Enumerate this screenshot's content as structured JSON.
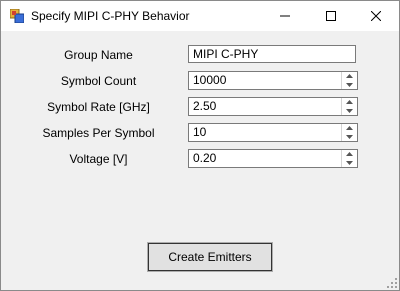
{
  "window": {
    "title": "Specify MIPI C-PHY Behavior",
    "controls": {
      "minimize": "–",
      "maximize": "☐",
      "close": "✕"
    },
    "icon": "app-icon"
  },
  "form": {
    "group_name": {
      "label": "Group Name",
      "value": "MIPI C-PHY"
    },
    "symbol_count": {
      "label": "Symbol Count",
      "value": "10000"
    },
    "symbol_rate": {
      "label": "Symbol Rate [GHz]",
      "value": "2.50"
    },
    "samples_per_symbol": {
      "label": "Samples Per Symbol",
      "value": "10"
    },
    "voltage": {
      "label": "Voltage [V]",
      "value": "0.20"
    }
  },
  "actions": {
    "create_label": "Create Emitters"
  }
}
